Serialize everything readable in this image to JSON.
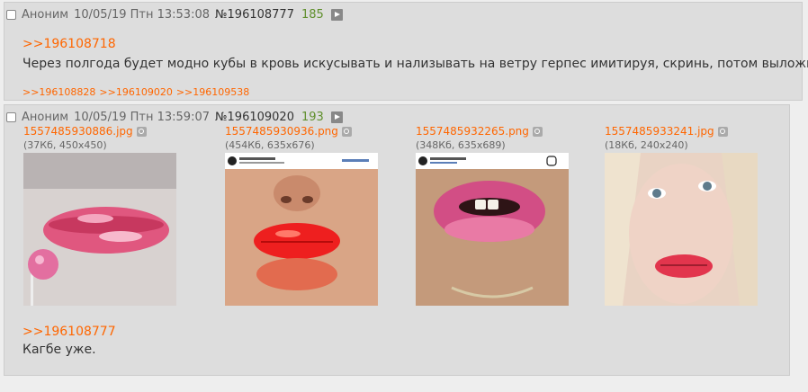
{
  "post1": {
    "name": "Аноним",
    "date": "10/05/19 Птн 13:53:08",
    "number": "№196108777",
    "count": "185",
    "reply_to": ">>196108718",
    "text": "Через полгода будет модно кубы в кровь искусывать и нализывать на ветру герпес имитируя, скринь, потом выложишь.",
    "backlinks": [
      ">>196108828",
      ">>196109020",
      ">>196109538"
    ]
  },
  "post2": {
    "name": "Аноним",
    "date": "10/05/19 Птн 13:59:07",
    "number": "№196109020",
    "count": "193",
    "files": [
      {
        "name": "1557485930886.jpg",
        "info": "(37Кб, 450x450)"
      },
      {
        "name": "1557485930936.png",
        "info": "(454Кб, 635x676)"
      },
      {
        "name": "1557485932265.png",
        "info": "(348Кб, 635x689)"
      },
      {
        "name": "1557485933241.jpg",
        "info": "(18Кб, 240x240)"
      }
    ],
    "reply_to": ">>196108777",
    "text": "Кагбе уже."
  },
  "colors": {
    "link": "#ff6600",
    "post_bg": "#dddddd",
    "page_bg": "#eeeeee",
    "count": "#5f8f2c"
  },
  "icons": [
    "checkbox-icon",
    "play-icon",
    "zoom-icon"
  ]
}
